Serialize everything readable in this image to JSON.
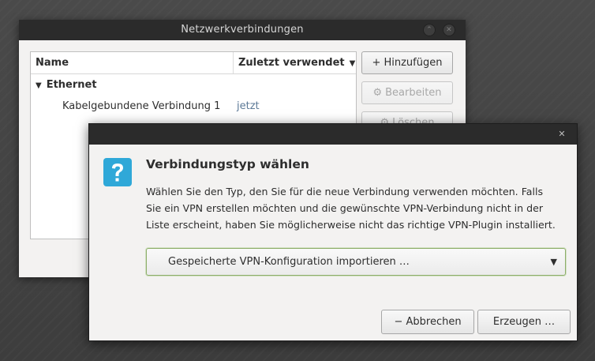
{
  "main_window": {
    "title": "Netzwerkverbindungen",
    "minimize_glyph": "⌃",
    "close_glyph": "✕",
    "columns": {
      "name": "Name",
      "last_used": "Zuletzt verwendet"
    },
    "sort_glyph": "▼",
    "group": {
      "expander_glyph": "▼",
      "label": "Ethernet"
    },
    "connection": {
      "name": "Kabelgebundene Verbindung 1",
      "last_used": "jetzt"
    },
    "buttons": {
      "add": {
        "icon": "+",
        "label": "Hinzufügen"
      },
      "edit": {
        "icon": "⚙",
        "label": "Bearbeiten"
      },
      "delete": {
        "icon": "⚙",
        "label": "Löschen"
      }
    }
  },
  "dialog": {
    "close_glyph": "✕",
    "icon": "question-icon",
    "title": "Verbindungstyp wählen",
    "body_lines": [
      "Wählen Sie den Typ, den Sie für die neue Verbindung verwenden möchten. Falls",
      "Sie ein VPN erstellen möchten und die gewünschte VPN-Verbindung nicht in der",
      "Liste erscheint, haben Sie möglicherweise nicht das richtige VPN-Plugin installiert."
    ],
    "combo": {
      "selected": "Gespeicherte VPN-Konfiguration importieren …",
      "arrow": "▼"
    },
    "buttons": {
      "cancel": {
        "icon": "−",
        "label": "Abbrechen"
      },
      "create": {
        "label": "Erzeugen …"
      }
    }
  },
  "colors": {
    "accent_blue": "#2fa8d8",
    "focus_green": "#8dae6a",
    "titlebar": "#2b2b2b"
  }
}
